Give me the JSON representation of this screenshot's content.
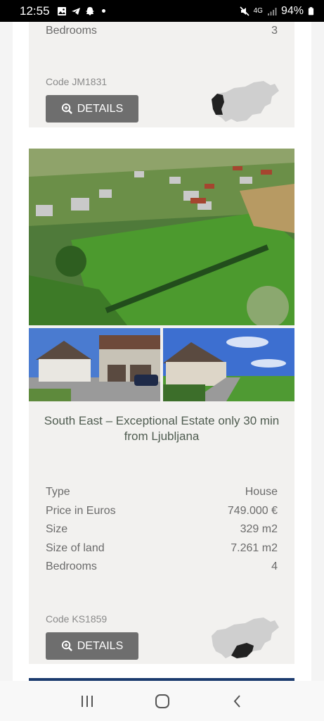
{
  "status_bar": {
    "time": "12:55",
    "battery": "94%",
    "network": "4G"
  },
  "card_top": {
    "spec": {
      "label": "Bedrooms",
      "value": "3"
    },
    "code": "Code JM1831",
    "details_label": "DETAILS"
  },
  "card_main": {
    "title": "South East – Exceptional Estate only 30 min from Ljubljana",
    "specs": [
      {
        "label": "Type",
        "value": "House"
      },
      {
        "label": "Price in Euros",
        "value": "749.000 €"
      },
      {
        "label": "Size",
        "value": "329 m2"
      },
      {
        "label": "Size of land",
        "value": "7.261 m2"
      },
      {
        "label": "Bedrooms",
        "value": "4"
      }
    ],
    "code": "Code KS1859",
    "details_label": "DETAILS"
  },
  "colors": {
    "card_bg": "#f2f1ef",
    "button_bg": "#6e6e6e",
    "title_color": "#4f5c50",
    "map_region_highlight": "#222222",
    "map_base": "#cfcfcf",
    "next_card_bar": "#1c3b6e"
  },
  "icons": [
    "gallery-icon",
    "telegram-icon",
    "snapchat-icon",
    "mute-icon",
    "signal-icon",
    "battery-icon",
    "search-zoom-icon",
    "slovenia-map",
    "recent-apps-icon",
    "home-icon",
    "back-icon"
  ]
}
